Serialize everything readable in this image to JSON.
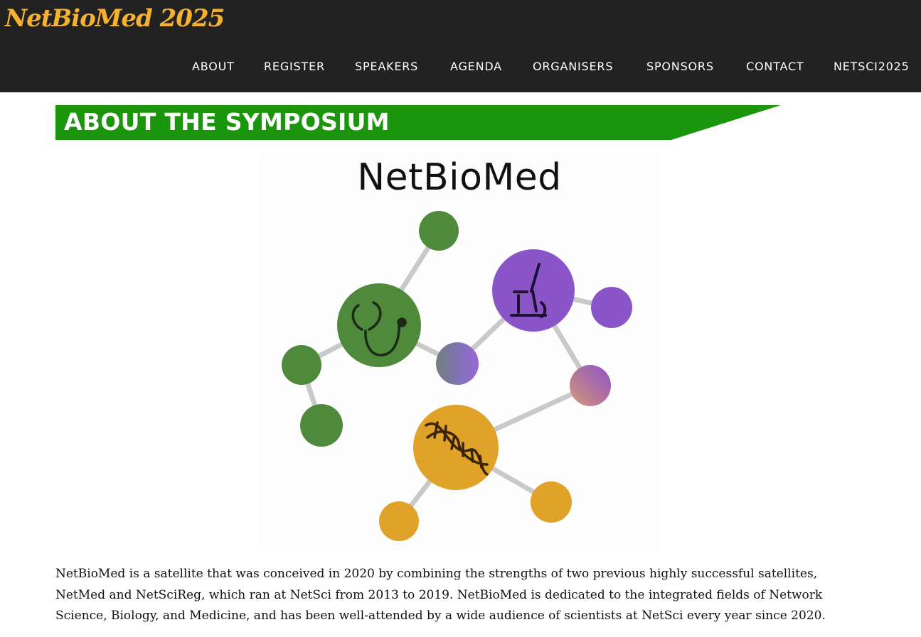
{
  "header": {
    "brand": "NetBioMed 2025",
    "nav": [
      "ABOUT",
      "REGISTER",
      "SPEAKERS",
      "AGENDA",
      "ORGANISERS",
      "SPONSORS",
      "CONTACT",
      "NETSCI2025"
    ]
  },
  "section": {
    "title": "ABOUT THE SYMPOSIUM"
  },
  "logo": {
    "title": "NetBioMed"
  },
  "about": {
    "text": "NetBioMed is a satellite that was conceived in 2020 by combining the strengths of two previous highly successful satellites, NetMed and NetSciReg, which ran at NetSci from 2013 to 2019. NetBioMed is dedicated to the integrated fields of Network Science, Biology, and Medicine, and has been well-attended by a wide audience of scientists at NetSci every year since 2020."
  },
  "colors": {
    "header_bg": "#222222",
    "brand": "#f6b22e",
    "banner": "#1b960c",
    "green_node": "#4f8a3c",
    "purple_node": "#8a55c9",
    "orange_node": "#e0a228"
  },
  "icons": [
    "stethoscope-icon",
    "microscope-icon",
    "dna-icon"
  ]
}
